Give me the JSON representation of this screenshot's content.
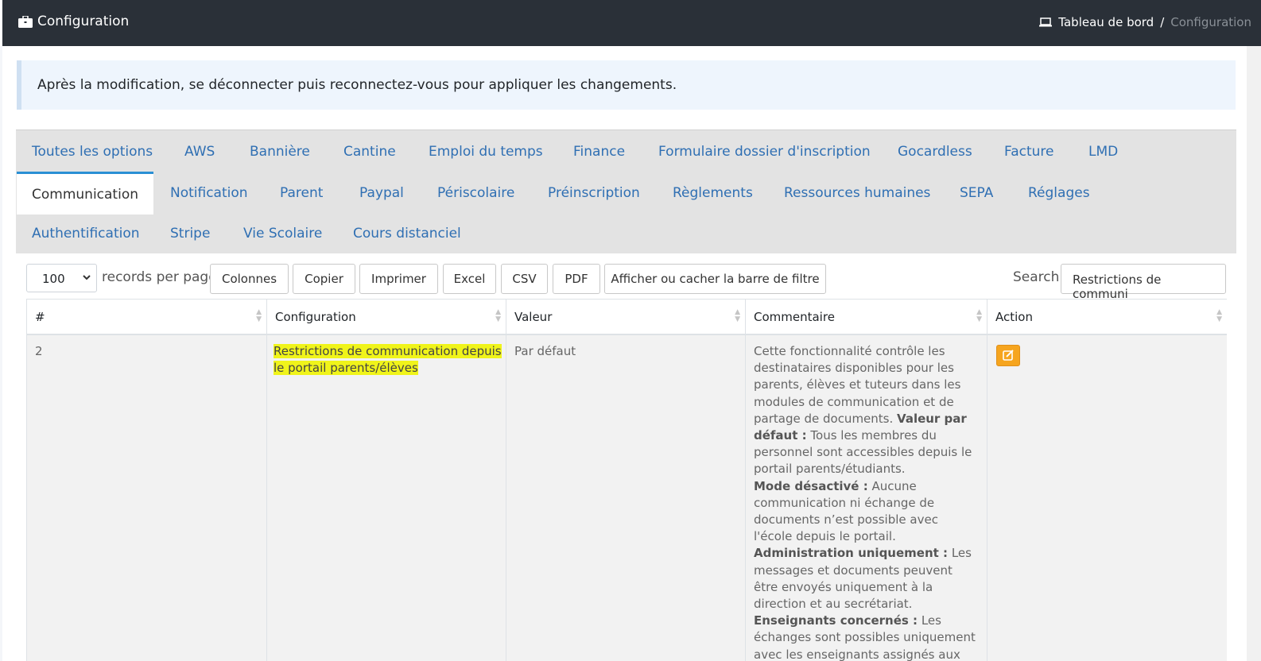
{
  "header": {
    "title": "Configuration",
    "breadcrumb": {
      "home": "Tableau de bord",
      "separator": "/",
      "current": "Configuration"
    }
  },
  "alert": {
    "text": "Après la modification, se déconnecter puis reconnectez-vous pour appliquer les changements."
  },
  "tabs": [
    [
      "Toutes les options",
      "AWS",
      "Bannière",
      "Cantine",
      "Emploi du temps",
      "Finance",
      "Formulaire dossier d'inscription",
      "Gocardless",
      "Facture",
      "LMD"
    ],
    [
      "Communication",
      "Notification",
      "Parent",
      "Paypal",
      "Périscolaire",
      "Préinscription",
      "Règlements",
      "Ressources humaines",
      "SEPA",
      "Réglages"
    ],
    [
      "Authentification",
      "Stripe",
      "Vie Scolaire",
      "Cours distanciel"
    ]
  ],
  "active_tab": "Communication",
  "toolbar": {
    "page_size": "100",
    "records_label": "records per page",
    "buttons": [
      "Colonnes",
      "Copier",
      "Imprimer",
      "Excel",
      "CSV",
      "PDF",
      "Afficher ou cacher la barre de filtre"
    ],
    "search_label": "Search:",
    "search_value": "Restrictions de communi"
  },
  "table": {
    "columns": [
      "#",
      "Configuration",
      "Valeur",
      "Commentaire",
      "Action"
    ],
    "rows": [
      {
        "id": "2",
        "configuration": "Restrictions de communication depuis le portail parents/élèves",
        "valeur": "Par défaut",
        "commentaire": [
          {
            "bold": false,
            "text": "Cette fonctionnalité contrôle les destinataires disponibles pour les parents, élèves et tuteurs dans les modules de communication et de partage de documents. "
          },
          {
            "bold": true,
            "text": "Valeur par défaut :"
          },
          {
            "bold": false,
            "text": " Tous les membres du personnel sont accessibles depuis le portail parents/étudiants."
          },
          {
            "bold": true,
            "text": "Mode désactivé :"
          },
          {
            "bold": false,
            "text": " Aucune communication ni échange de documents n’est possible avec l'école depuis le portail."
          },
          {
            "bold": true,
            "text": "Administration uniquement :"
          },
          {
            "bold": false,
            "text": " Les messages et documents peuvent être envoyés uniquement à la direction et au secrétariat."
          },
          {
            "bold": true,
            "text": "Enseignants concernés :"
          },
          {
            "bold": false,
            "text": " Les échanges sont possibles uniquement avec les enseignants assignés aux élèves, en plus"
          }
        ]
      }
    ]
  },
  "colors": {
    "topbar": "#2a3038",
    "link": "#2f6fb3",
    "tab_active_border": "#2a8fd4",
    "highlight": "#f0f41a",
    "edit_button": "#f6a51f"
  },
  "icons": {
    "title": "briefcase-icon",
    "home": "laptop-icon",
    "edit": "edit-icon"
  }
}
